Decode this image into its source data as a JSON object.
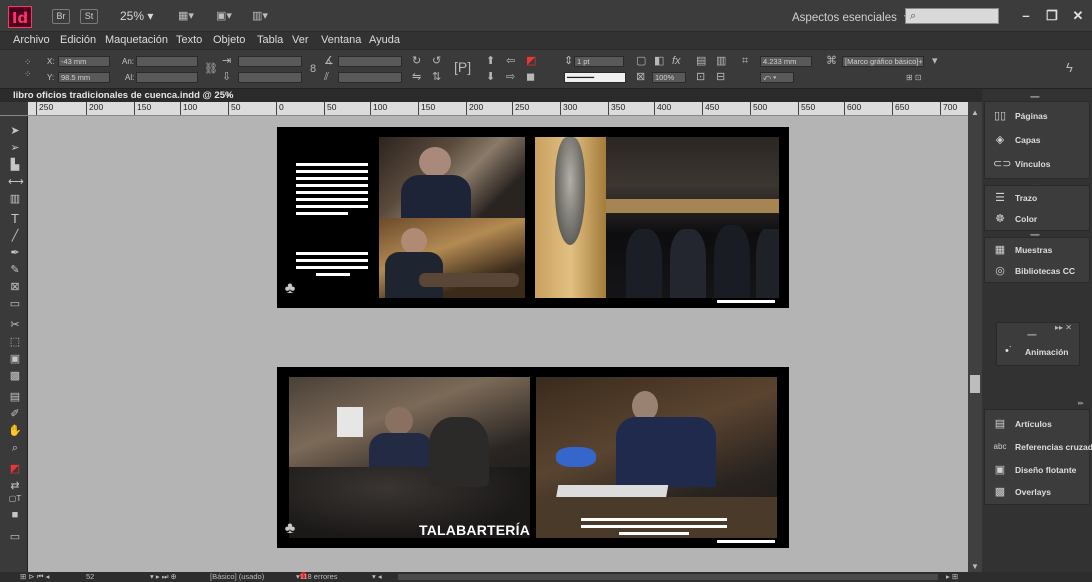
{
  "app": {
    "logo_text": "Id",
    "bridge_label": "Br",
    "stock_label": "St",
    "zoom": "25% ▾",
    "workspace": "Aspectos esenciales",
    "workspace_caret": "▾"
  },
  "menu": [
    "Archivo",
    "Edición",
    "Maquetación",
    "Texto",
    "Objeto",
    "Tabla",
    "Ver",
    "Ventana",
    "Ayuda"
  ],
  "control": {
    "x_label": "X:",
    "x_value": "-43 mm",
    "y_label": "Y:",
    "y_value": "98.5 mm",
    "w_label": "An:",
    "h_label": "Al:",
    "stroke_weight": "1 pt",
    "opacity": "100%",
    "size_value": "4.233 mm",
    "frame_style": "[Marco gráfico básico]+"
  },
  "document": {
    "tab_title": "libro oficios tradicionales de cuenca.indd @ 25%",
    "close": "×"
  },
  "ruler": {
    "ticks": [
      "250",
      "200",
      "150",
      "100",
      "50",
      "0",
      "50",
      "100",
      "150",
      "200",
      "250",
      "300",
      "350",
      "400",
      "450",
      "500",
      "550",
      "600",
      "650",
      "700"
    ]
  },
  "spread2": {
    "heading": "TALABARTERÍA"
  },
  "panels": {
    "group1": [
      "Páginas",
      "Capas",
      "Vínculos"
    ],
    "group2": [
      "Trazo",
      "Color"
    ],
    "group3": [
      "Muestras",
      "Bibliotecas CC"
    ],
    "floating": "Animación",
    "group4": [
      "Artículos",
      "Referencias cruzadas",
      "Diseño flotante",
      "Overlays"
    ]
  },
  "status": {
    "page": "52",
    "master": "[Básico] (usado)",
    "errors": "118 errores"
  },
  "colors": {
    "accent": "#ff3366",
    "canvas": "#b4b4b4",
    "chrome": "#323232"
  }
}
